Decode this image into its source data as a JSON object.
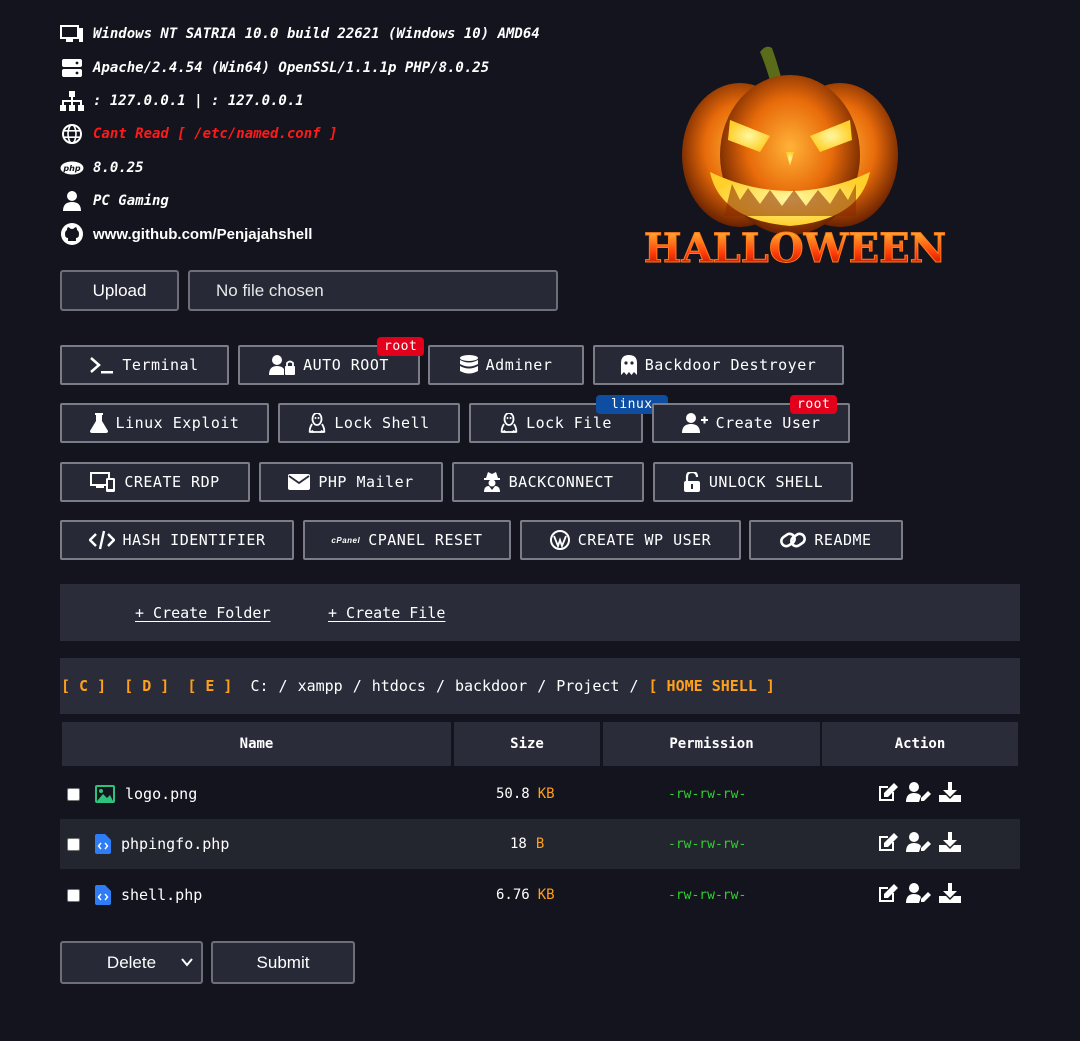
{
  "info": {
    "os": "Windows NT SATRIA 10.0 build 22621 (Windows 10) AMD64",
    "server": "Apache/2.4.54 (Win64) OpenSSL/1.1.1p PHP/8.0.25",
    "ip": ": 127.0.0.1 | : 127.0.0.1",
    "named": "Cant Read [ /etc/named.conf ]",
    "php_version": "8.0.25",
    "user": "PC Gaming",
    "github": "www.github.com/Penjajahshell"
  },
  "banner": {
    "text": "HALLOWEEN"
  },
  "upload": {
    "button": "Upload",
    "file_status": "No file chosen"
  },
  "tools": {
    "terminal": "Terminal",
    "auto_root": "AUTO ROOT",
    "adminer": "Adminer",
    "backdoor_destroyer": "Backdoor Destroyer",
    "linux_exploit": "Linux Exploit",
    "lock_shell": "Lock Shell",
    "lock_file": "Lock File",
    "create_user": "Create User",
    "create_rdp": "CREATE RDP",
    "php_mailer": "PHP Mailer",
    "backconnect": "BACKCONNECT",
    "unlock_shell": "UNLOCK SHELL",
    "hash_identifier": "HASH IDENTIFIER",
    "cpanel_reset": "CPANEL RESET",
    "create_wp_user": "CREATE WP USER",
    "readme": "README",
    "cpanel_logo": "cPanel"
  },
  "tags": {
    "root": "root",
    "linux": "linux"
  },
  "create": {
    "folder": "+ Create Folder",
    "file": "+ Create File"
  },
  "path": {
    "drives": [
      "[ C ]",
      "[ D ]",
      "[ E ]"
    ],
    "segments": [
      "C:",
      "/",
      "xampp",
      "/",
      "htdocs",
      "/",
      "backdoor",
      "/",
      "Project",
      "/"
    ],
    "home": "[ HOME SHELL ]"
  },
  "table": {
    "headers": [
      "Name",
      "Size",
      "Permission",
      "Action"
    ],
    "rows": [
      {
        "name": "logo.png",
        "size": "50.8",
        "unit": "KB",
        "perm": "-rw-rw-rw-"
      },
      {
        "name": "phpingfo.php",
        "size": "18",
        "unit": "B",
        "perm": "-rw-rw-rw-"
      },
      {
        "name": "shell.php",
        "size": "6.76",
        "unit": "KB",
        "perm": "-rw-rw-rw-"
      }
    ]
  },
  "bottom": {
    "select_value": "Delete",
    "submit": "Submit"
  },
  "colors": {
    "accent_orange": "#ff9f1a",
    "perm_green": "#2fd02f",
    "error_red": "#ff1a1a",
    "root_tag": "#e3001b",
    "linux_tag": "#0d4ea3"
  }
}
